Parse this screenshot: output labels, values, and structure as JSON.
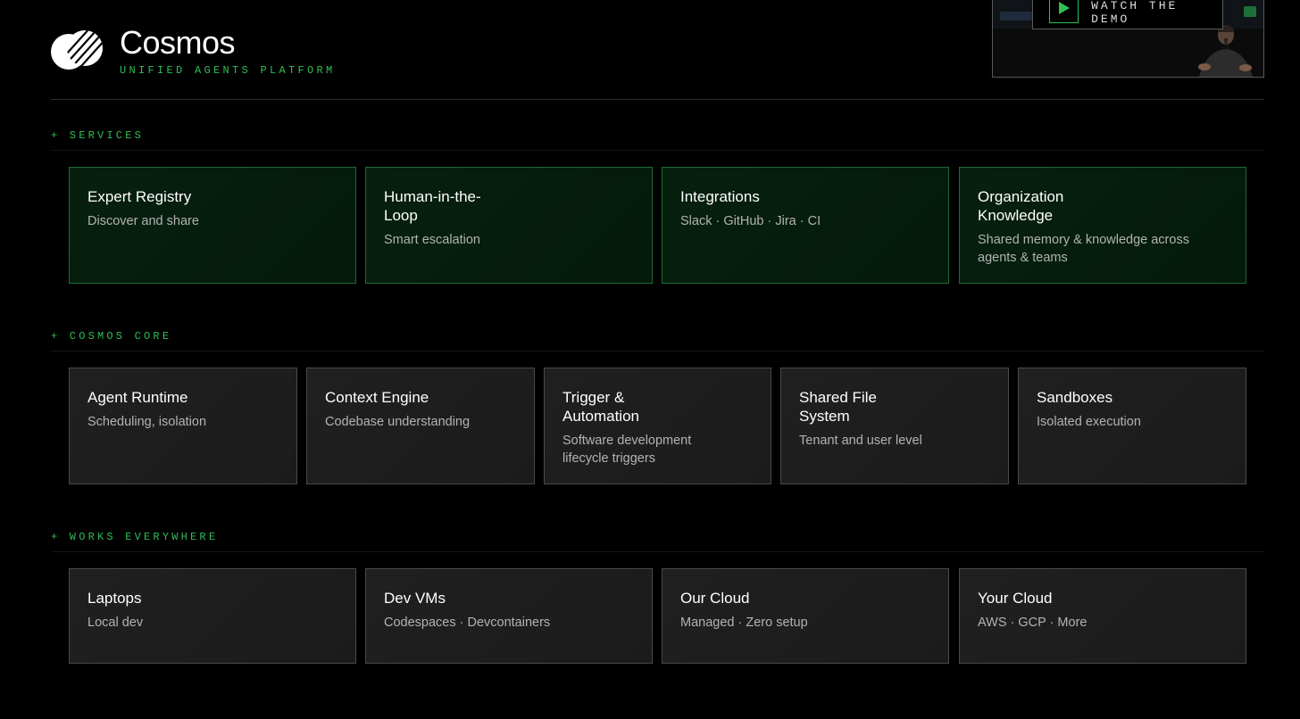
{
  "header": {
    "title": "Cosmos",
    "subtitle": "UNIFIED AGENTS PLATFORM",
    "logo_icon": "cosmos-logo-icon"
  },
  "video": {
    "cta_label": "WATCH THE DEMO",
    "play_icon": "play-icon"
  },
  "colors": {
    "accent": "#2fbf55",
    "background": "#000000",
    "services_card_bg": "#06200f",
    "core_card_bg": "#1e1e1e"
  },
  "sections": {
    "services": {
      "label": "+ SERVICES",
      "cards": [
        {
          "title": "Expert Registry",
          "desc": "Discover and share"
        },
        {
          "title": "Human-in-the-\nLoop",
          "desc": "Smart escalation"
        },
        {
          "title": "Integrations",
          "desc": "Slack · GitHub · Jira · CI"
        },
        {
          "title": "Organization\nKnowledge",
          "desc": "Shared memory & knowledge across agents & teams"
        }
      ]
    },
    "core": {
      "label": "+ COSMOS CORE",
      "cards": [
        {
          "title": "Agent Runtime",
          "desc": "Scheduling, isolation"
        },
        {
          "title": "Context Engine",
          "desc": "Codebase understanding"
        },
        {
          "title": "Trigger &\nAutomation",
          "desc": "Software development lifecycle triggers"
        },
        {
          "title": "Shared File\nSystem",
          "desc": "Tenant and user level"
        },
        {
          "title": "Sandboxes",
          "desc": "Isolated execution"
        }
      ]
    },
    "everywhere": {
      "label": "+ WORKS EVERYWHERE",
      "cards": [
        {
          "title": "Laptops",
          "desc": "Local dev"
        },
        {
          "title": "Dev VMs",
          "desc": "Codespaces · Devcontainers"
        },
        {
          "title": "Our Cloud",
          "desc": "Managed · Zero setup"
        },
        {
          "title": "Your Cloud",
          "desc": "AWS · GCP · More"
        }
      ]
    }
  }
}
